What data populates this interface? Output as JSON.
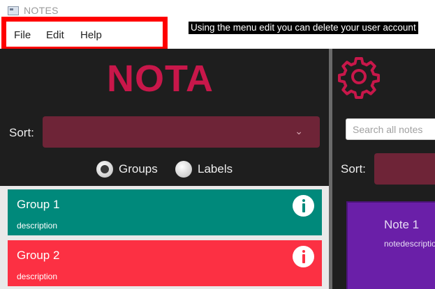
{
  "window": {
    "title": "NOTES"
  },
  "menu": {
    "items": [
      {
        "label": "File"
      },
      {
        "label": "Edit"
      },
      {
        "label": "Help"
      }
    ]
  },
  "annotation": {
    "text": "Using the menu edit you can delete your user account"
  },
  "left": {
    "logo": "NOTA",
    "sort_label": "Sort:",
    "sort_value": "",
    "view_options": [
      {
        "label": "Groups",
        "checked": true
      },
      {
        "label": "Labels",
        "checked": false
      }
    ],
    "groups": [
      {
        "name": "Group 1",
        "description": "description",
        "color": "#00897b"
      },
      {
        "name": "Group 2",
        "description": "description",
        "color": "#fc3043"
      }
    ]
  },
  "right": {
    "search_placeholder": "Search all notes",
    "sort_label": "Sort:",
    "notes": [
      {
        "title": "Note 1",
        "description": "notedescription",
        "color": "#6a1fa8"
      }
    ]
  },
  "colors": {
    "accent": "#c8174a",
    "select_bg": "#6e2437",
    "panel_bg": "#1e1e1e",
    "highlight": "#ff0000"
  },
  "icons": [
    "app-icon",
    "chevron-down-icon",
    "info-icon",
    "gear-icon"
  ]
}
